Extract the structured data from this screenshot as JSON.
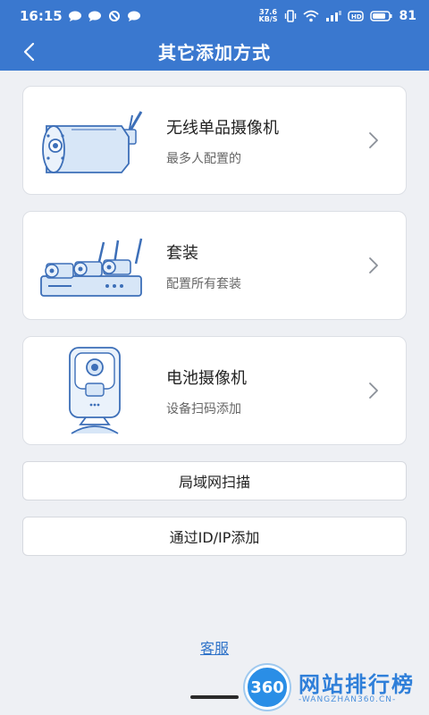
{
  "status_bar": {
    "time": "16:15",
    "net_speed_top": "37.6",
    "net_speed_bottom": "KB/S",
    "battery": "81",
    "left_icons": [
      "chat-bubble-icon",
      "chat-bubble-icon",
      "blocked-circle-icon",
      "chat-bubble-icon"
    ],
    "right_icons": [
      "vibrate-icon",
      "wifi-icon",
      "signal-icon",
      "hd-icon",
      "battery-icon"
    ]
  },
  "header": {
    "title": "其它添加方式",
    "back_icon": "chevron-left-icon"
  },
  "options": [
    {
      "title": "无线单品摄像机",
      "subtitle": "最多人配置的",
      "icon": "bullet-camera-illustration"
    },
    {
      "title": "套装",
      "subtitle": "配置所有套装",
      "icon": "camera-kit-illustration"
    },
    {
      "title": "电池摄像机",
      "subtitle": "设备扫码添加",
      "icon": "battery-camera-illustration"
    }
  ],
  "buttons": {
    "lan_scan": "局域网扫描",
    "add_by_ip": "通过ID/IP添加"
  },
  "footer": {
    "customer_service": "客服"
  },
  "watermark": {
    "badge": "360",
    "text": "网站排行榜",
    "url": "-WANGZHAN360.CN-"
  },
  "colors": {
    "header_bg": "#3a78cf",
    "page_bg": "#eef0f4",
    "link": "#2f73c9",
    "illustration_stroke": "#3d6fb8",
    "illustration_fill": "#d7e6f7"
  }
}
